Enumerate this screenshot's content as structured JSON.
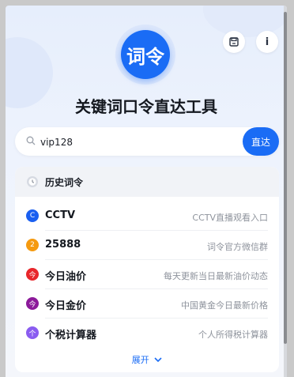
{
  "app": {
    "logo_text": "词令",
    "title": "关键词口令直达工具",
    "info_label": "i"
  },
  "search": {
    "value": "vip128",
    "button_label": "直达"
  },
  "history": {
    "title": "历史词令",
    "items": [
      {
        "badge": "C",
        "name": "CCTV",
        "desc": "CCTV直播观看入口",
        "color": "#1a5ff0"
      },
      {
        "badge": "2",
        "name": "25888",
        "desc": "词令官方微信群",
        "color": "#f59a10"
      },
      {
        "badge": "今",
        "name": "今日油价",
        "desc": "每天更新当日最新油价动态",
        "color": "#e8262b"
      },
      {
        "badge": "今",
        "name": "今日金价",
        "desc": "中国黄金今日最新价格",
        "color": "#8c1a9a"
      },
      {
        "badge": "个",
        "name": "个税计算器",
        "desc": "个人所得税计算器",
        "color": "#8a5cf0"
      }
    ],
    "expand_label": "展开"
  },
  "colors": {
    "accent": "#1a6cf5"
  }
}
